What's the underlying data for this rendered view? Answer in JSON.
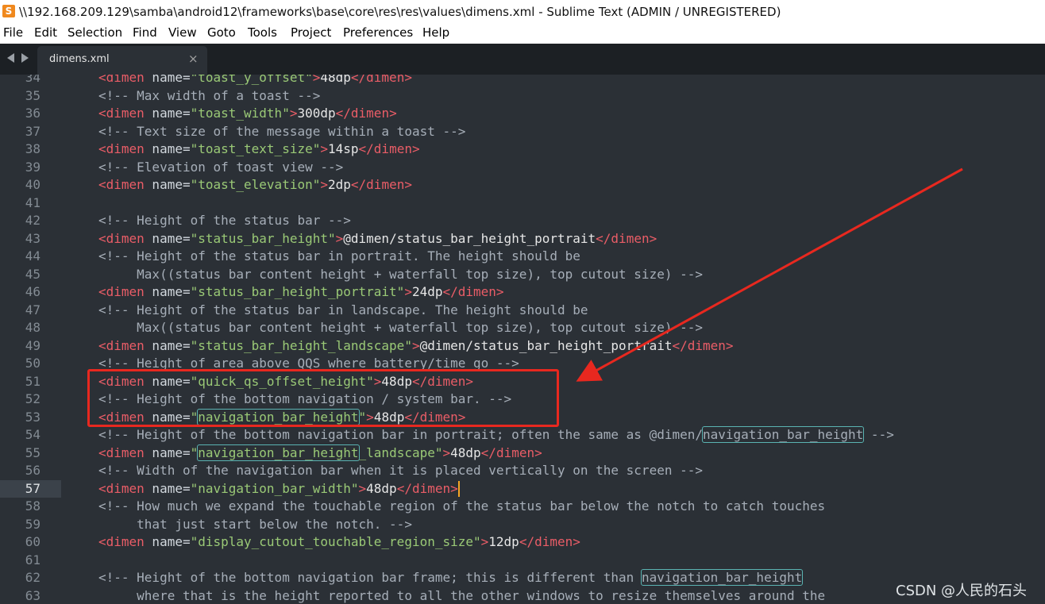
{
  "window": {
    "title": "\\\\192.168.209.129\\samba\\android12\\frameworks\\base\\core\\res\\res\\values\\dimens.xml - Sublime Text (ADMIN / UNREGISTERED)",
    "app_icon": "S"
  },
  "menu": [
    "File",
    "Edit",
    "Selection",
    "Find",
    "View",
    "Goto",
    "Tools",
    "Project",
    "Preferences",
    "Help"
  ],
  "tab": {
    "label": "dimens.xml",
    "close": "×"
  },
  "current_line": "57",
  "lines": [
    {
      "n": "34",
      "segs": [
        {
          "c": "c-tag",
          "t": "<dimen"
        },
        {
          "c": "c-attr",
          "t": " name="
        },
        {
          "c": "c-str",
          "t": "\"toast_y_offset\""
        },
        {
          "c": "c-tag",
          "t": ">"
        },
        {
          "c": "c-txt",
          "t": "48dp"
        },
        {
          "c": "c-tag",
          "t": "</dimen>"
        }
      ]
    },
    {
      "n": "35",
      "segs": [
        {
          "c": "c-cm",
          "t": "<!-- Max width of a toast -->"
        }
      ]
    },
    {
      "n": "36",
      "segs": [
        {
          "c": "c-tag",
          "t": "<dimen"
        },
        {
          "c": "c-attr",
          "t": " name="
        },
        {
          "c": "c-str",
          "t": "\"toast_width\""
        },
        {
          "c": "c-tag",
          "t": ">"
        },
        {
          "c": "c-txt",
          "t": "300dp"
        },
        {
          "c": "c-tag",
          "t": "</dimen>"
        }
      ]
    },
    {
      "n": "37",
      "segs": [
        {
          "c": "c-cm",
          "t": "<!-- Text size of the message within a toast -->"
        }
      ]
    },
    {
      "n": "38",
      "segs": [
        {
          "c": "c-tag",
          "t": "<dimen"
        },
        {
          "c": "c-attr",
          "t": " name="
        },
        {
          "c": "c-str",
          "t": "\"toast_text_size\""
        },
        {
          "c": "c-tag",
          "t": ">"
        },
        {
          "c": "c-txt",
          "t": "14sp"
        },
        {
          "c": "c-tag",
          "t": "</dimen>"
        }
      ]
    },
    {
      "n": "39",
      "segs": [
        {
          "c": "c-cm",
          "t": "<!-- Elevation of toast view -->"
        }
      ]
    },
    {
      "n": "40",
      "segs": [
        {
          "c": "c-tag",
          "t": "<dimen"
        },
        {
          "c": "c-attr",
          "t": " name="
        },
        {
          "c": "c-str",
          "t": "\"toast_elevation\""
        },
        {
          "c": "c-tag",
          "t": ">"
        },
        {
          "c": "c-txt",
          "t": "2dp"
        },
        {
          "c": "c-tag",
          "t": "</dimen>"
        }
      ]
    },
    {
      "n": "41",
      "segs": []
    },
    {
      "n": "42",
      "segs": [
        {
          "c": "c-cm",
          "t": "<!-- Height of the status bar -->"
        }
      ]
    },
    {
      "n": "43",
      "segs": [
        {
          "c": "c-tag",
          "t": "<dimen"
        },
        {
          "c": "c-attr",
          "t": " name="
        },
        {
          "c": "c-str",
          "t": "\"status_bar_height\""
        },
        {
          "c": "c-tag",
          "t": ">"
        },
        {
          "c": "c-txt",
          "t": "@dimen/status_bar_height_portrait"
        },
        {
          "c": "c-tag",
          "t": "</dimen>"
        }
      ]
    },
    {
      "n": "44",
      "segs": [
        {
          "c": "c-cm",
          "t": "<!-- Height of the status bar in portrait. The height should be"
        }
      ]
    },
    {
      "n": "45",
      "segs": [
        {
          "c": "c-cm",
          "t": "     Max((status bar content height + waterfall top size), top cutout size) -->"
        }
      ]
    },
    {
      "n": "46",
      "segs": [
        {
          "c": "c-tag",
          "t": "<dimen"
        },
        {
          "c": "c-attr",
          "t": " name="
        },
        {
          "c": "c-str",
          "t": "\"status_bar_height_portrait\""
        },
        {
          "c": "c-tag",
          "t": ">"
        },
        {
          "c": "c-txt",
          "t": "24dp"
        },
        {
          "c": "c-tag",
          "t": "</dimen>"
        }
      ]
    },
    {
      "n": "47",
      "segs": [
        {
          "c": "c-cm",
          "t": "<!-- Height of the status bar in landscape. The height should be"
        }
      ]
    },
    {
      "n": "48",
      "segs": [
        {
          "c": "c-cm",
          "t": "     Max((status bar content height + waterfall top size), top cutout size) -->"
        }
      ]
    },
    {
      "n": "49",
      "segs": [
        {
          "c": "c-tag",
          "t": "<dimen"
        },
        {
          "c": "c-attr",
          "t": " name="
        },
        {
          "c": "c-str",
          "t": "\"status_bar_height_landscape\""
        },
        {
          "c": "c-tag",
          "t": ">"
        },
        {
          "c": "c-txt",
          "t": "@dimen/status_bar_height_portrait"
        },
        {
          "c": "c-tag",
          "t": "</dimen>"
        }
      ]
    },
    {
      "n": "50",
      "segs": [
        {
          "c": "c-cm",
          "t": "<!-- Height of area above QQS where battery/time go -->"
        }
      ]
    },
    {
      "n": "51",
      "segs": [
        {
          "c": "c-tag",
          "t": "<dimen"
        },
        {
          "c": "c-attr",
          "t": " name="
        },
        {
          "c": "c-str",
          "t": "\"quick_qs_offset_height\""
        },
        {
          "c": "c-tag",
          "t": ">"
        },
        {
          "c": "c-txt",
          "t": "48dp"
        },
        {
          "c": "c-tag",
          "t": "</dimen>"
        }
      ]
    },
    {
      "n": "52",
      "segs": [
        {
          "c": "c-cm",
          "t": "<!-- Height of the bottom navigation / system bar. -->"
        }
      ]
    },
    {
      "n": "53",
      "segs": [
        {
          "c": "c-tag",
          "t": "<dimen"
        },
        {
          "c": "c-attr",
          "t": " name="
        },
        {
          "c": "c-str",
          "t": "\""
        },
        {
          "c": "c-str",
          "t": "navigation_bar_height",
          "hl": true
        },
        {
          "c": "c-str",
          "t": "\""
        },
        {
          "c": "c-tag",
          "t": ">"
        },
        {
          "c": "c-txt",
          "t": "48dp"
        },
        {
          "c": "c-tag",
          "t": "</dimen>"
        }
      ]
    },
    {
      "n": "54",
      "segs": [
        {
          "c": "c-cm",
          "t": "<!-- Height of the bottom navigation bar in portrait; often the same as @dimen/"
        },
        {
          "c": "c-cm",
          "t": "navigation_bar_height",
          "hl": true
        },
        {
          "c": "c-cm",
          "t": " -->"
        }
      ]
    },
    {
      "n": "55",
      "segs": [
        {
          "c": "c-tag",
          "t": "<dimen"
        },
        {
          "c": "c-attr",
          "t": " name="
        },
        {
          "c": "c-str",
          "t": "\""
        },
        {
          "c": "c-str",
          "t": "navigation_bar_height",
          "hl": true
        },
        {
          "c": "c-str",
          "t": "_landscape\""
        },
        {
          "c": "c-tag",
          "t": ">"
        },
        {
          "c": "c-txt",
          "t": "48dp"
        },
        {
          "c": "c-tag",
          "t": "</dimen>"
        }
      ]
    },
    {
      "n": "56",
      "segs": [
        {
          "c": "c-cm",
          "t": "<!-- Width of the navigation bar when it is placed vertically on the screen -->"
        }
      ]
    },
    {
      "n": "57",
      "segs": [
        {
          "c": "c-tag",
          "t": "<dimen"
        },
        {
          "c": "c-attr",
          "t": " name="
        },
        {
          "c": "c-str",
          "t": "\"navigation_bar_width\""
        },
        {
          "c": "c-tag",
          "t": ">"
        },
        {
          "c": "c-txt",
          "t": "48dp"
        },
        {
          "c": "c-tag",
          "t": "</dimen>"
        }
      ],
      "caret": true
    },
    {
      "n": "58",
      "segs": [
        {
          "c": "c-cm",
          "t": "<!-- How much we expand the touchable region of the status bar below the notch to catch touches"
        }
      ]
    },
    {
      "n": "59",
      "segs": [
        {
          "c": "c-cm",
          "t": "     that just start below the notch. -->"
        }
      ]
    },
    {
      "n": "60",
      "segs": [
        {
          "c": "c-tag",
          "t": "<dimen"
        },
        {
          "c": "c-attr",
          "t": " name="
        },
        {
          "c": "c-str",
          "t": "\"display_cutout_touchable_region_size\""
        },
        {
          "c": "c-tag",
          "t": ">"
        },
        {
          "c": "c-txt",
          "t": "12dp"
        },
        {
          "c": "c-tag",
          "t": "</dimen>"
        }
      ]
    },
    {
      "n": "61",
      "segs": []
    },
    {
      "n": "62",
      "segs": [
        {
          "c": "c-cm",
          "t": "<!-- Height of the bottom navigation bar frame; this is different than "
        },
        {
          "c": "c-cm",
          "t": "navigation_bar_height",
          "hl": true
        }
      ]
    },
    {
      "n": "63",
      "segs": [
        {
          "c": "c-cm",
          "t": "     where that is the height reported to all the other windows to resize themselves around the"
        }
      ]
    }
  ],
  "annotation": {
    "color": "#e8281f",
    "target_lines": [
      "51",
      "52",
      "53"
    ]
  },
  "watermark": "CSDN @人民的石头"
}
